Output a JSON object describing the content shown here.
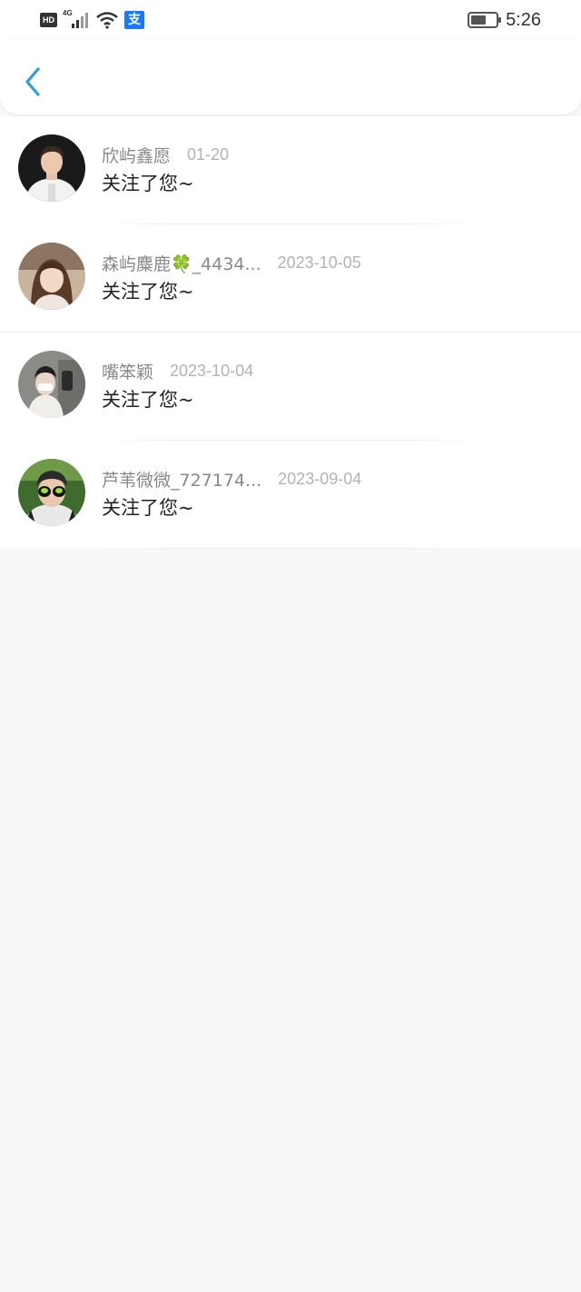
{
  "status_bar": {
    "hd": "HD",
    "network": "4G",
    "alipay_glyph": "支",
    "time": "5:26",
    "battery_level": 0.5
  },
  "header": {
    "back_icon": "chevron-left-icon",
    "accent_color": "#2a9fde"
  },
  "notifications": [
    {
      "name": "欣屿鑫愿",
      "date": "01-20",
      "message": "关注了您~"
    },
    {
      "name": "森屿麋鹿🍀_4434...",
      "date": "2023-10-05",
      "message": "关注了您~"
    },
    {
      "name": "嘴笨颖",
      "date": "2023-10-04",
      "message": "关注了您~"
    },
    {
      "name": "芦苇微微_727174...",
      "date": "2023-09-04",
      "message": "关注了您~"
    }
  ]
}
